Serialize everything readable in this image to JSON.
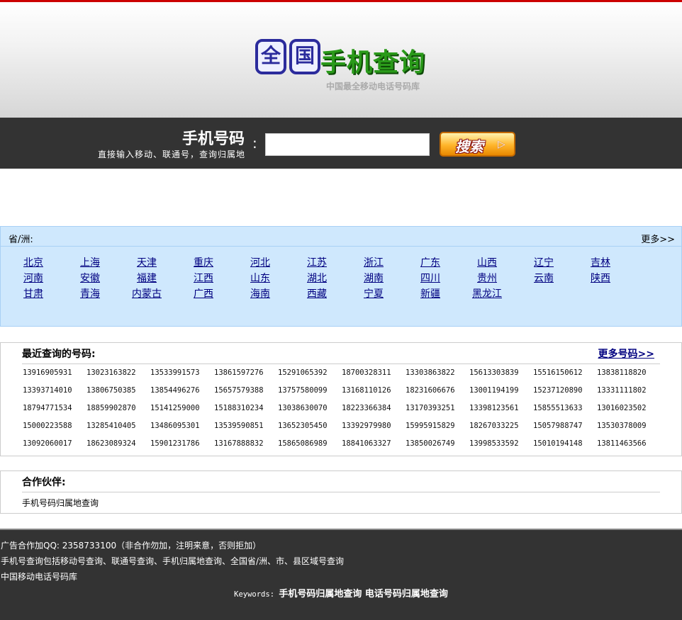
{
  "header": {
    "logo_glyph_1": "全",
    "logo_glyph_2": "国",
    "logo_text": "手机查询",
    "slogan": "中国最全移动电话号码库",
    "colors": {
      "top_line": "#cc0000",
      "logo_green": "#2a9a1a",
      "logo_blue": "#2b2b9c"
    }
  },
  "search": {
    "title": "手机号码",
    "subtitle": "直接输入移动、联通号，查询归属地",
    "colon": ":",
    "input_value": "",
    "input_placeholder": "",
    "button_label": "搜索",
    "button_icon": "play-arrow-icon"
  },
  "provinces": {
    "label": "省/洲:",
    "more": "更多>>",
    "rows": [
      [
        "北京",
        "上海",
        "天津",
        "重庆",
        "河北",
        "江苏",
        "浙江",
        "广东",
        "山西",
        "辽宁",
        "吉林"
      ],
      [
        "河南",
        "安徽",
        "福建",
        "江西",
        "山东",
        "湖北",
        "湖南",
        "四川",
        "贵州",
        "云南",
        "陕西"
      ],
      [
        "甘肃",
        "青海",
        "内蒙古",
        "广西",
        "海南",
        "西藏",
        "宁夏",
        "新疆",
        "黑龙江"
      ]
    ]
  },
  "recent": {
    "title": "最近查询的号码:",
    "more": "更多号码>>",
    "rows": [
      [
        "13916905931",
        "13023163822",
        "13533991573",
        "13861597276",
        "15291065392",
        "18700328311",
        "13303863822",
        "15613303839",
        "15516150612",
        "13838118820"
      ],
      [
        "13393714010",
        "13806750385",
        "13854496276",
        "15657579388",
        "13757580099",
        "13168110126",
        "18231606676",
        "13001194199",
        "15237120890",
        "13331111802"
      ],
      [
        "18794771534",
        "18859902870",
        "15141259000",
        "15188310234",
        "13038630070",
        "18223366384",
        "13170393251",
        "13398123561",
        "15855513633",
        "13016023502"
      ],
      [
        "15000223588",
        "13285410405",
        "13486095301",
        "13539590851",
        "13652305450",
        "13392979980",
        "15995915829",
        "18267033225",
        "15057988747",
        "13530378009"
      ],
      [
        "13092060017",
        "18623089324",
        "15901231786",
        "13167888832",
        "15865086989",
        "18841063327",
        "13850026749",
        "13998533592",
        "15010194148",
        "13811463566"
      ]
    ]
  },
  "partners": {
    "title": "合作伙伴:",
    "items": [
      "手机号码归属地查询"
    ]
  },
  "footer": {
    "line1": "广告合作加QQ: 2358733100（非合作勿加，注明来意，否则拒加）",
    "line2": "手机号查询包括移动号查询、联通号查询、手机归属地查询、全国省/洲、市、县区域号查询",
    "line3": "中国移动电话号码库",
    "keywords_label": "Keywords: ",
    "keywords": "手机号码归属地查询 电话号码归属地查询"
  }
}
